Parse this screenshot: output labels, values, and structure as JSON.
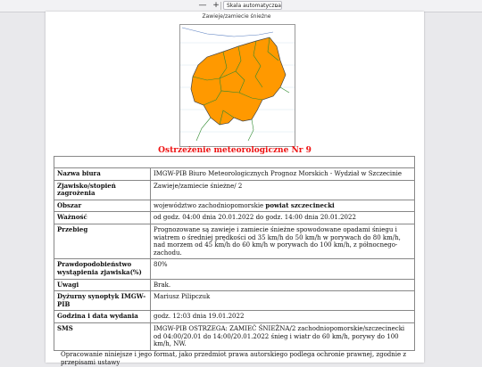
{
  "toolbar": {
    "zoom_out_label": "—",
    "zoom_in_label": "+",
    "zoom_select_value": "Skala automatyczna",
    "zoom_chevron": "⌄"
  },
  "map": {
    "title": "Zawieje/zamiecie śnieżne",
    "alert_color": "#ff9900"
  },
  "document": {
    "headline": "Ostrzeżenie meteorologiczne Nr 9",
    "rows": [
      {
        "key": "Nazwa biura",
        "value": "IMGW-PIB Biuro Meteorologicznych Prognoz Morskich - Wydział w Szczecinie"
      },
      {
        "key": "Zjawisko/stopień zagrożenia",
        "value": "Zawieje/zamiecie śnieżne/ 2"
      },
      {
        "key": "Obszar",
        "value_prefix": "województwo zachodniopomorskie ",
        "value_bold": "powiat szczecinecki"
      },
      {
        "key": "Ważność",
        "value": "od godz. 04:00 dnia 20.01.2022 do godz. 14:00 dnia 20.01.2022"
      },
      {
        "key": "Przebieg",
        "value": "Prognozowane są zawieje i zamiecie śnieżne spowodowane opadami śniegu i wiatrem o średniej prędkości od 35 km/h do 50 km/h w porywach do 80 km/h, nad morzem od 45 km/h do 60 km/h w porywach do 100 km/h, z północnego-zachodu."
      },
      {
        "key": "Prawdopodobieństwo wystąpienia zjawiska(%)",
        "value": "80%"
      },
      {
        "key": "Uwagi",
        "value": "Brak."
      },
      {
        "key": "Dyżurny synoptyk IMGW-PIB",
        "value": "Mariusz Pilipczuk"
      },
      {
        "key": "Godzina i data wydania",
        "value": "godz. 12:03 dnia 19.01.2022"
      },
      {
        "key": "SMS",
        "value": "IMGW-PIB OSTRZEGA: ZAMIEĆ ŚNIEŻNA/2 zachodniopomorskie/szczecinecki od 04:00/20.01 do 14:00/20.01.2022 śnieg i wiatr do 60 km/h, porywy do 100 km/h, NW."
      }
    ],
    "footer": "Opracowanie niniejsze i jego format, jako przedmiot prawa autorskiego podlega ochronie prawnej, zgodnie z przepisami ustawy"
  }
}
